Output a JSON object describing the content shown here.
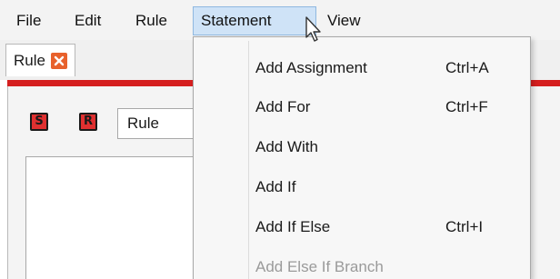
{
  "menubar": {
    "items": [
      "File",
      "Edit",
      "Rule",
      "Statement",
      "View"
    ],
    "active": "Statement"
  },
  "tab": {
    "label": "Rule"
  },
  "toolbar": {
    "s_button": "S",
    "r_button": "R",
    "rule_name_value": "Rule"
  },
  "statement_menu": {
    "items": [
      {
        "label": "Add Assignment",
        "shortcut": "Ctrl+A",
        "enabled": true
      },
      {
        "label": "Add For",
        "shortcut": "Ctrl+F",
        "enabled": true
      },
      {
        "label": "Add With",
        "shortcut": "",
        "enabled": true
      },
      {
        "label": "Add If",
        "shortcut": "",
        "enabled": true
      },
      {
        "label": "Add If Else",
        "shortcut": "Ctrl+I",
        "enabled": true
      },
      {
        "label": "Add Else If Branch",
        "shortcut": "",
        "enabled": false
      }
    ]
  },
  "colors": {
    "accent_red": "#d51f1f",
    "menu_highlight": "#cfe3f7",
    "tab_close": "#e8612c",
    "disabled_text": "#9a9a9a"
  },
  "icons": [
    "close-icon",
    "mouse-cursor-icon"
  ]
}
